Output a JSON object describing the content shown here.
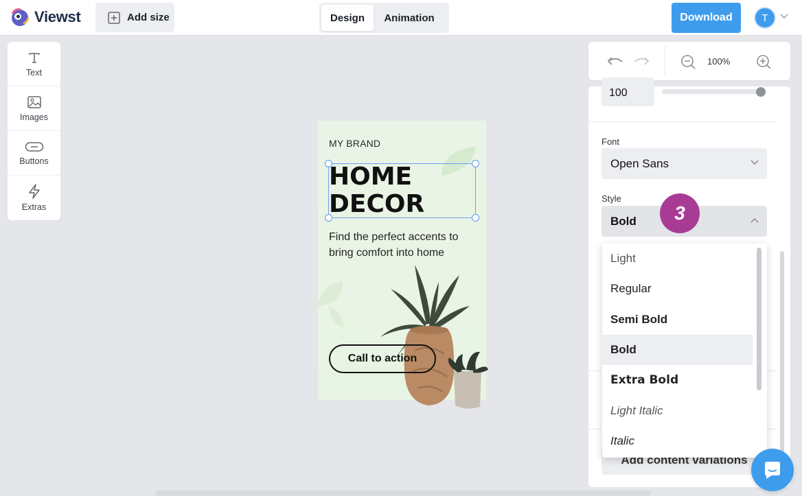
{
  "app": {
    "name": "Viewst"
  },
  "toolbar": {
    "add_size_label": "Add size",
    "tabs": [
      {
        "label": "Design",
        "active": true
      },
      {
        "label": "Animation",
        "active": false
      }
    ],
    "download_label": "Download",
    "avatar_initial": "T"
  },
  "tools": [
    {
      "label": "Text",
      "icon": "text-icon"
    },
    {
      "label": "Images",
      "icon": "image-icon"
    },
    {
      "label": "Buttons",
      "icon": "button-icon"
    },
    {
      "label": "Extras",
      "icon": "lightning-icon"
    }
  ],
  "canvas": {
    "brand": "MY BRAND",
    "headline": "HOME\nDECOR",
    "subline": "Find the perfect accents to bring comfort into home",
    "cta": "Call to action"
  },
  "zoom": {
    "value": "100%"
  },
  "properties": {
    "opacity_value": "100",
    "opacity_level": 1.0,
    "font_label": "Font",
    "font_value": "Open Sans",
    "style_label": "Style",
    "style_value": "Bold",
    "style_options": [
      {
        "label": "Light",
        "selected": false
      },
      {
        "label": "Regular",
        "selected": false
      },
      {
        "label": "Semi Bold",
        "selected": false
      },
      {
        "label": "Bold",
        "selected": true
      },
      {
        "label": "Extra Bold",
        "selected": false
      },
      {
        "label": "Light Italic",
        "selected": false
      },
      {
        "label": "Italic",
        "selected": false
      }
    ],
    "add_variations_label": "Add content variations"
  },
  "step_badge": "3",
  "colors": {
    "accent": "#3e9cec",
    "badge": "#a83c95",
    "artboard_bg": "#e8f4e3"
  }
}
